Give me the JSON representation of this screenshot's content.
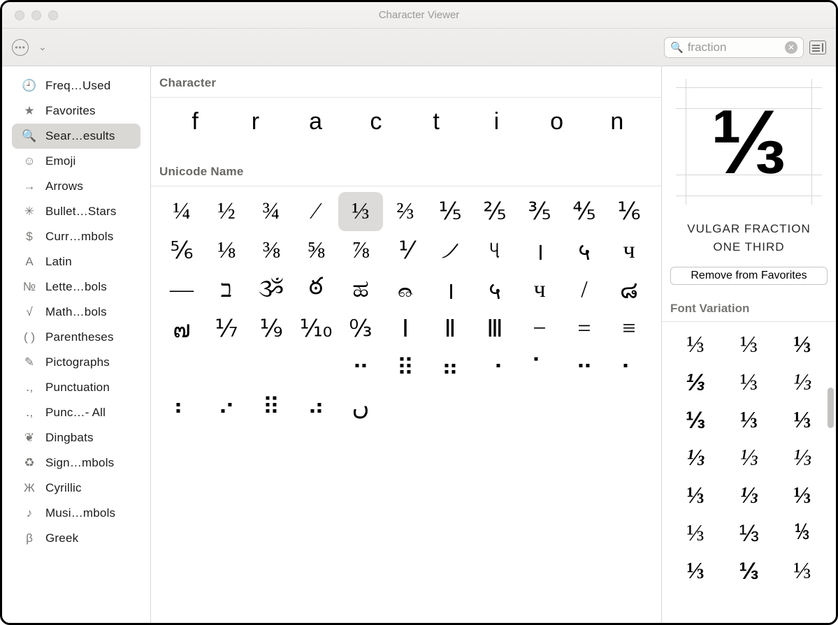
{
  "window": {
    "title": "Character Viewer"
  },
  "search": {
    "query": "fraction"
  },
  "sidebar": {
    "items": [
      {
        "icon": "🕘",
        "label": "Freq…Used"
      },
      {
        "icon": "★",
        "label": "Favorites"
      },
      {
        "icon": "🔍",
        "label": "Sear…esults",
        "selected": true
      },
      {
        "icon": "☺",
        "label": "Emoji"
      },
      {
        "icon": "→",
        "label": "Arrows"
      },
      {
        "icon": "✳",
        "label": "Bullet…Stars"
      },
      {
        "icon": "$",
        "label": "Curr…mbols"
      },
      {
        "icon": "A",
        "label": "Latin"
      },
      {
        "icon": "№",
        "label": "Lette…bols"
      },
      {
        "icon": "√",
        "label": "Math…bols"
      },
      {
        "icon": "( )",
        "label": "Parentheses"
      },
      {
        "icon": "✎",
        "label": "Pictographs"
      },
      {
        "icon": "․,",
        "label": "Punctuation"
      },
      {
        "icon": "․,",
        "label": "Punc…- All"
      },
      {
        "icon": "❦",
        "label": "Dingbats"
      },
      {
        "icon": "♻",
        "label": "Sign…mbols"
      },
      {
        "icon": "Ж",
        "label": "Cyrillic"
      },
      {
        "icon": "♪",
        "label": "Musi…mbols"
      },
      {
        "icon": "β",
        "label": "Greek"
      }
    ]
  },
  "sections": {
    "character_header": "Character",
    "unicode_header": "Unicode Name"
  },
  "char_letters": [
    "f",
    "r",
    "a",
    "c",
    "t",
    "i",
    "o",
    "n"
  ],
  "unicode_chars": [
    "¼",
    "½",
    "¾",
    "⁄",
    "⅓",
    "⅔",
    "⅕",
    "⅖",
    "⅗",
    "⅘",
    "⅙",
    "⅚",
    "⅛",
    "⅜",
    "⅝",
    "⅞",
    "⅟",
    "୵",
    "୳",
    "।",
    "५",
    "ч",
    "—",
    "ב",
    "ૐ",
    "ఠ",
    "ಹ",
    "෬",
    "।",
    "५",
    "ч",
    "/",
    "๘",
    "๗",
    "⅐",
    "⅑",
    "⅒",
    "↉",
    "Ⅰ",
    "Ⅱ",
    "Ⅲ",
    "−",
    "=",
    "≡",
    "",
    "",
    "",
    "",
    "⠒",
    "⠿",
    "⠶",
    "⠐",
    "⠁",
    "⠒",
    "⠂",
    "⠆",
    "⠔",
    "⠿",
    "⠴",
    "ں",
    "",
    "",
    "",
    "",
    "",
    ""
  ],
  "selected_index": 4,
  "detail": {
    "glyph": "⅓",
    "name_line1": "VULGAR FRACTION",
    "name_line2": "ONE THIRD",
    "favorites_button": "Remove from Favorites",
    "font_variation_header": "Font Variation",
    "variations": [
      {
        "g": "⅓",
        "f": "Helvetica Neue",
        "w": "300",
        "st": "normal"
      },
      {
        "g": "⅓",
        "f": "Georgia",
        "w": "400",
        "st": "normal"
      },
      {
        "g": "⅓",
        "f": "Arial Black",
        "w": "800",
        "st": "normal"
      },
      {
        "g": "⅓",
        "f": "Arial",
        "w": "800",
        "st": "italic"
      },
      {
        "g": "⅓",
        "f": "Times New Roman",
        "w": "400",
        "st": "normal"
      },
      {
        "g": "⅓",
        "f": "Georgia",
        "w": "400",
        "st": "italic"
      },
      {
        "g": "⅓",
        "f": "Arial",
        "w": "700",
        "st": "normal"
      },
      {
        "g": "⅓",
        "f": "Helvetica Neue",
        "w": "700",
        "st": "normal"
      },
      {
        "g": "⅓",
        "f": "Verdana",
        "w": "700",
        "st": "normal"
      },
      {
        "g": "⅓",
        "f": "Georgia",
        "w": "700",
        "st": "italic"
      },
      {
        "g": "⅓",
        "f": "Times New Roman",
        "w": "400",
        "st": "italic"
      },
      {
        "g": "⅓",
        "f": "Palatino",
        "w": "400",
        "st": "italic"
      },
      {
        "g": "⅓",
        "f": "Impact",
        "w": "800",
        "st": "normal"
      },
      {
        "g": "⅓",
        "f": "Arial Black",
        "w": "900",
        "st": "italic"
      },
      {
        "g": "⅓",
        "f": "Tahoma",
        "w": "800",
        "st": "normal"
      },
      {
        "g": "⅓",
        "f": "Georgia",
        "w": "300",
        "st": "normal"
      },
      {
        "g": "⅓",
        "f": "Helvetica",
        "w": "400",
        "st": "normal"
      },
      {
        "g": "⅓",
        "f": "Courier New",
        "w": "400",
        "st": "normal"
      },
      {
        "g": "⅓",
        "f": "Verdana",
        "w": "900",
        "st": "normal"
      },
      {
        "g": "⅓",
        "f": "Arial",
        "w": "900",
        "st": "normal"
      },
      {
        "g": "⅓",
        "f": "Times",
        "w": "400",
        "st": "normal"
      }
    ]
  }
}
